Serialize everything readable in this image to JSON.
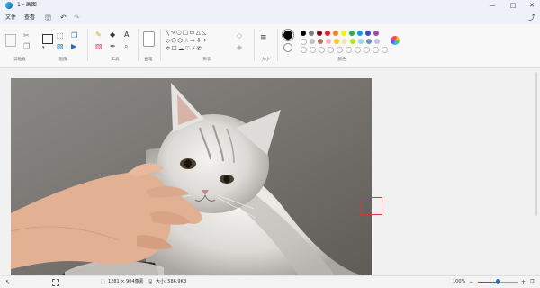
{
  "window": {
    "title": "1 - 画图",
    "minimize": "—",
    "maximize": "□",
    "close": "✕"
  },
  "menu": {
    "file": "文件",
    "view": "查看"
  },
  "ribbon": {
    "groups": [
      "剪贴板",
      "图像",
      "工具",
      "画笔",
      "形状",
      "大小",
      "颜色"
    ]
  },
  "palette": {
    "selected_primary": "#000000",
    "selected_secondary": "#ffffff",
    "row1": [
      "#000000",
      "#7f7f7f",
      "#880015",
      "#ed1c24",
      "#ff7f27",
      "#fff200",
      "#22b14c",
      "#00a2e8",
      "#3f48cc",
      "#a349a4"
    ],
    "row2": [
      "#ffffff",
      "#c3c3c3",
      "#b97a57",
      "#ffaec9",
      "#ffc90e",
      "#efe4b0",
      "#b5e61d",
      "#99d9ea",
      "#7092be",
      "#c8bfe7"
    ]
  },
  "status": {
    "dimensions": "1281 × 904像素",
    "size": "大小: 586.9KB",
    "zoom": "100%"
  },
  "icons": {
    "undo": "undo-icon",
    "redo": "redo-icon",
    "save": "save-icon",
    "share": "share-icon"
  }
}
